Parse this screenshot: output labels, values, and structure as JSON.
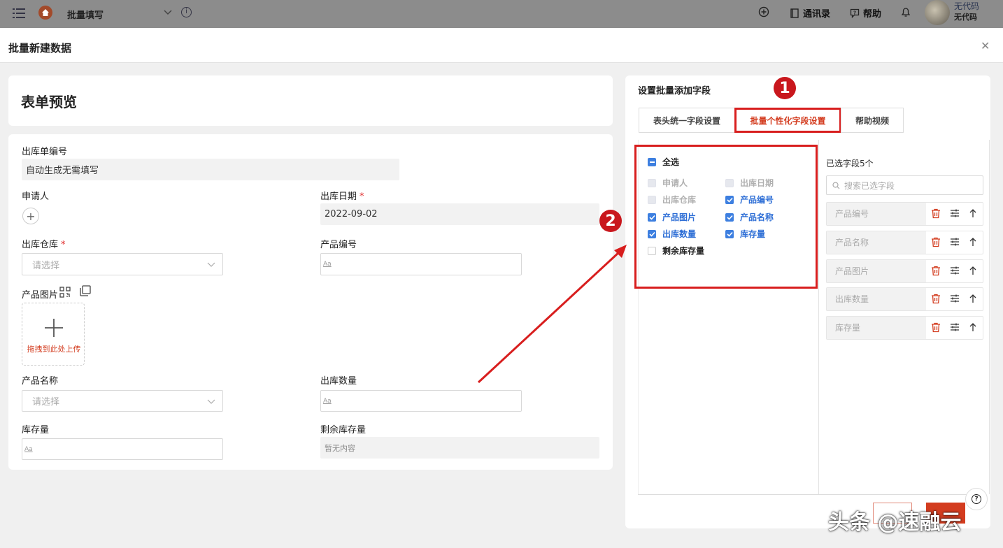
{
  "topbar": {
    "app_title": "批量填写",
    "contacts": "通讯录",
    "help": "帮助",
    "user_name": "无代码",
    "user_org": "无代码"
  },
  "modal": {
    "title": "批量新建数据"
  },
  "preview": {
    "title": "表单预览",
    "fields": {
      "order_no_label": "出库单编号",
      "order_no_value": "自动生成无需填写",
      "applicant_label": "申请人",
      "out_date_label": "出库日期",
      "out_date_value": "2022-09-02",
      "warehouse_label": "出库仓库",
      "warehouse_placeholder": "请选择",
      "product_code_label": "产品编号",
      "product_image_label": "产品图片",
      "upload_text": "拖拽到此处上传",
      "product_name_label": "产品名称",
      "product_name_placeholder": "请选择",
      "out_qty_label": "出库数量",
      "stock_label": "库存量",
      "remain_label": "剩余库存量",
      "remain_value": "暂无内容",
      "aa": "Aa"
    }
  },
  "settings": {
    "title": "设置批量添加字段",
    "tabs": [
      "表头统一字段设置",
      "批量个性化字段设置",
      "帮助视频"
    ],
    "badge1": "1",
    "badge2": "2",
    "select_all": "全选",
    "options": [
      {
        "label": "申请人",
        "state": "disabled"
      },
      {
        "label": "出库日期",
        "state": "disabled"
      },
      {
        "label": "出库仓库",
        "state": "disabled"
      },
      {
        "label": "产品编号",
        "state": "checked"
      },
      {
        "label": "产品图片",
        "state": "checked"
      },
      {
        "label": "产品名称",
        "state": "checked"
      },
      {
        "label": "出库数量",
        "state": "checked"
      },
      {
        "label": "库存量",
        "state": "checked"
      },
      {
        "label": "剩余库存量",
        "state": "unchecked"
      }
    ],
    "selected_count_label": "已选字段5个",
    "search_placeholder": "搜索已选字段",
    "selected": [
      "产品编号",
      "产品名称",
      "产品图片",
      "出库数量",
      "库存量"
    ]
  },
  "help_icon_label": "?",
  "watermark": "头条 @速融云",
  "colors": {
    "accent": "#d33c1f",
    "checkbox": "#3d7fe0",
    "annotation": "#d81e1e"
  }
}
